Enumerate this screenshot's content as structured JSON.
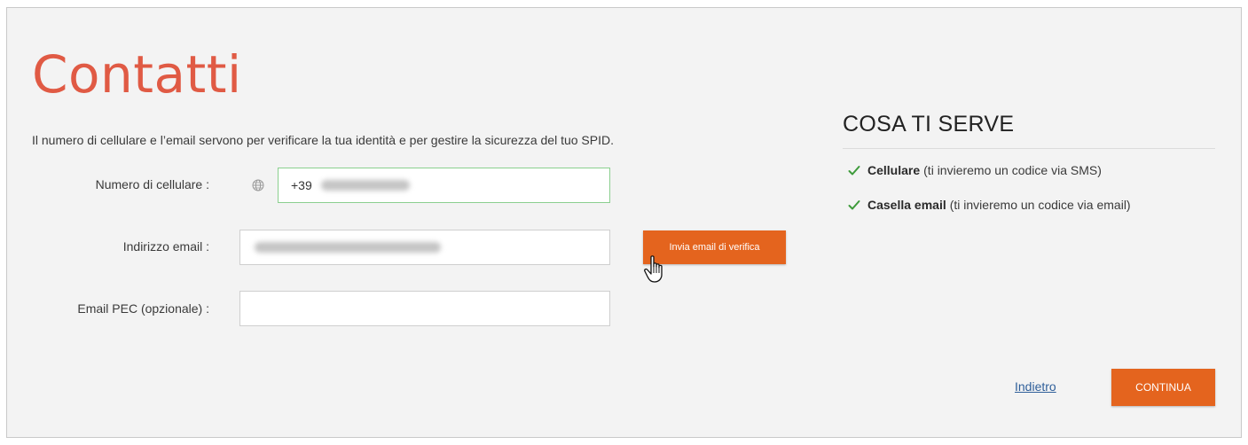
{
  "page": {
    "title": "Contatti",
    "intro": "Il numero di cellulare e l’email servono per verificare la tua identità e per gestire la sicurezza del tuo SPID."
  },
  "form": {
    "phone": {
      "label": "Numero di cellulare :",
      "prefix": "+39",
      "icon": "globe-icon"
    },
    "email": {
      "label": "Indirizzo email :"
    },
    "pec": {
      "label": "Email PEC (opzionale) :",
      "value": ""
    },
    "verify_button": "Invia email di verifica"
  },
  "sidebar": {
    "title": "COSA TI SERVE",
    "items": [
      {
        "bold": "Cellulare",
        "text": "(ti invieremo un codice via SMS)",
        "icon": "check-icon"
      },
      {
        "bold": "Casella email",
        "text": "(ti invieremo un codice via email)",
        "icon": "check-icon"
      }
    ]
  },
  "footer": {
    "back_link": "Indietro",
    "continue_button": "CONTINUA"
  },
  "colors": {
    "title": "#e05a44",
    "button": "#e4641e",
    "check": "#3d9a3a",
    "link": "#2f5f9a"
  }
}
